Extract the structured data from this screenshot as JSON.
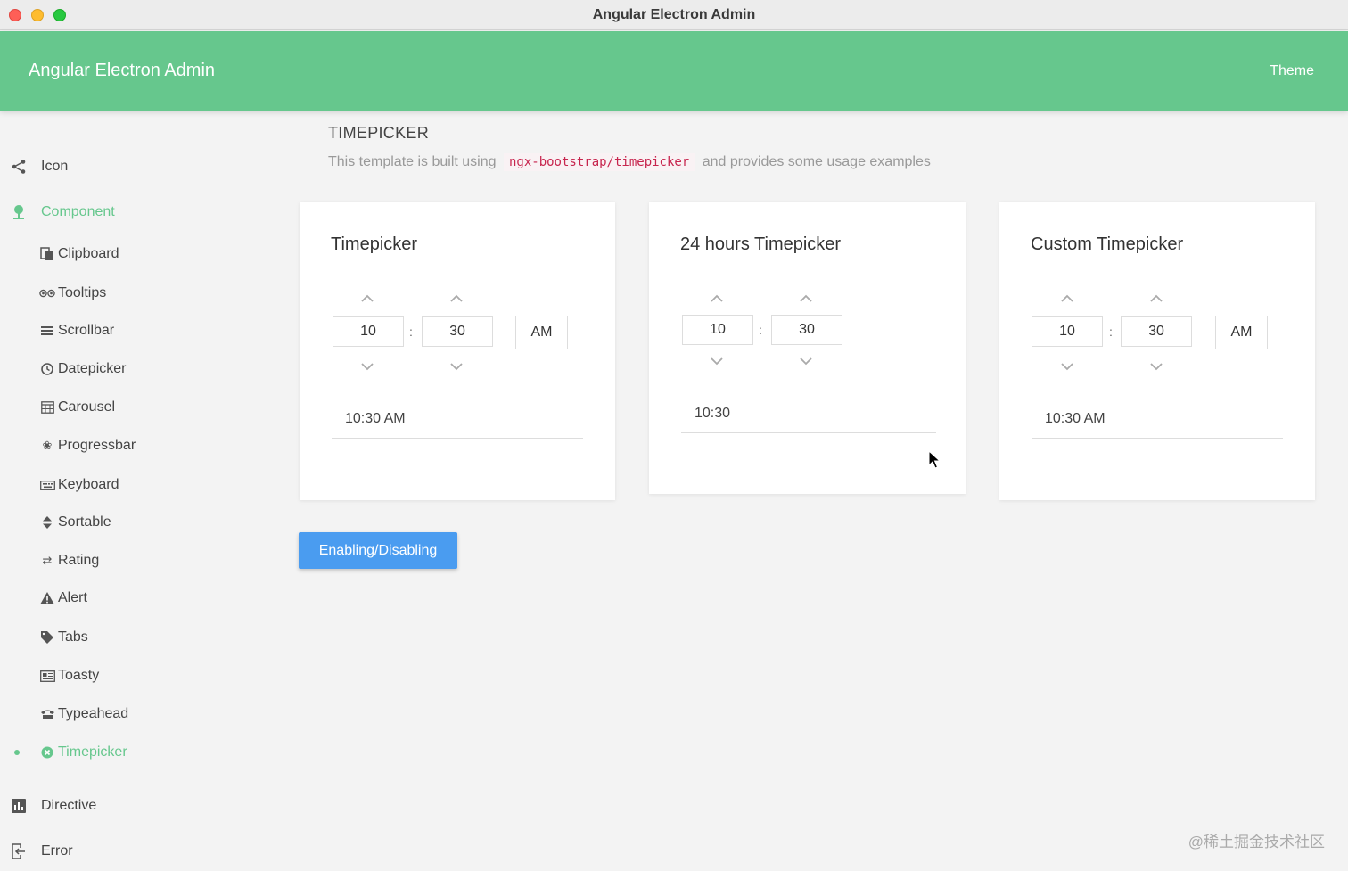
{
  "window": {
    "title": "Angular Electron Admin"
  },
  "appbar": {
    "title": "Angular Electron Admin",
    "theme_label": "Theme"
  },
  "sidebar": {
    "top_items": [
      {
        "label": "Icon",
        "icon": "share-icon"
      },
      {
        "label": "Component",
        "icon": "pin-icon",
        "active": true
      },
      {
        "label": "Directive",
        "icon": "bar-chart-icon"
      },
      {
        "label": "Error",
        "icon": "sign-out-icon"
      }
    ],
    "component_items": [
      {
        "label": "Clipboard",
        "icon": "clipboard-icon"
      },
      {
        "label": "Tooltips",
        "icon": "tooltips-icon"
      },
      {
        "label": "Scrollbar",
        "icon": "bars-icon"
      },
      {
        "label": "Datepicker",
        "icon": "clock-icon"
      },
      {
        "label": "Carousel",
        "icon": "calendar-grid-icon"
      },
      {
        "label": "Progressbar",
        "icon": "leaf-icon"
      },
      {
        "label": "Keyboard",
        "icon": "keyboard-icon"
      },
      {
        "label": "Sortable",
        "icon": "sort-icon"
      },
      {
        "label": "Rating",
        "icon": "shuffle-icon"
      },
      {
        "label": "Alert",
        "icon": "warning-icon"
      },
      {
        "label": "Tabs",
        "icon": "tag-icon"
      },
      {
        "label": "Toasty",
        "icon": "newspaper-icon"
      },
      {
        "label": "Typeahead",
        "icon": "phone-icon"
      },
      {
        "label": "Timepicker",
        "icon": "close-circle-icon",
        "active": true
      }
    ]
  },
  "page": {
    "heading": "TIMEPICKER",
    "desc_before": "This template is built using",
    "desc_code": "ngx-bootstrap/timepicker",
    "desc_after": "and provides some usage examples"
  },
  "cards": [
    {
      "title": "Timepicker",
      "hours": "10",
      "minutes": "30",
      "meridian": "AM",
      "result": "10:30 AM"
    },
    {
      "title": "24 hours Timepicker",
      "hours": "10",
      "minutes": "30",
      "result": "10:30"
    },
    {
      "title": "Custom Timepicker",
      "hours": "10",
      "minutes": "30",
      "meridian": "AM",
      "result": "10:30 AM"
    }
  ],
  "colon": ":",
  "toggle_button": "Enabling/Disabling",
  "watermark": "@稀土掘金技术社区"
}
